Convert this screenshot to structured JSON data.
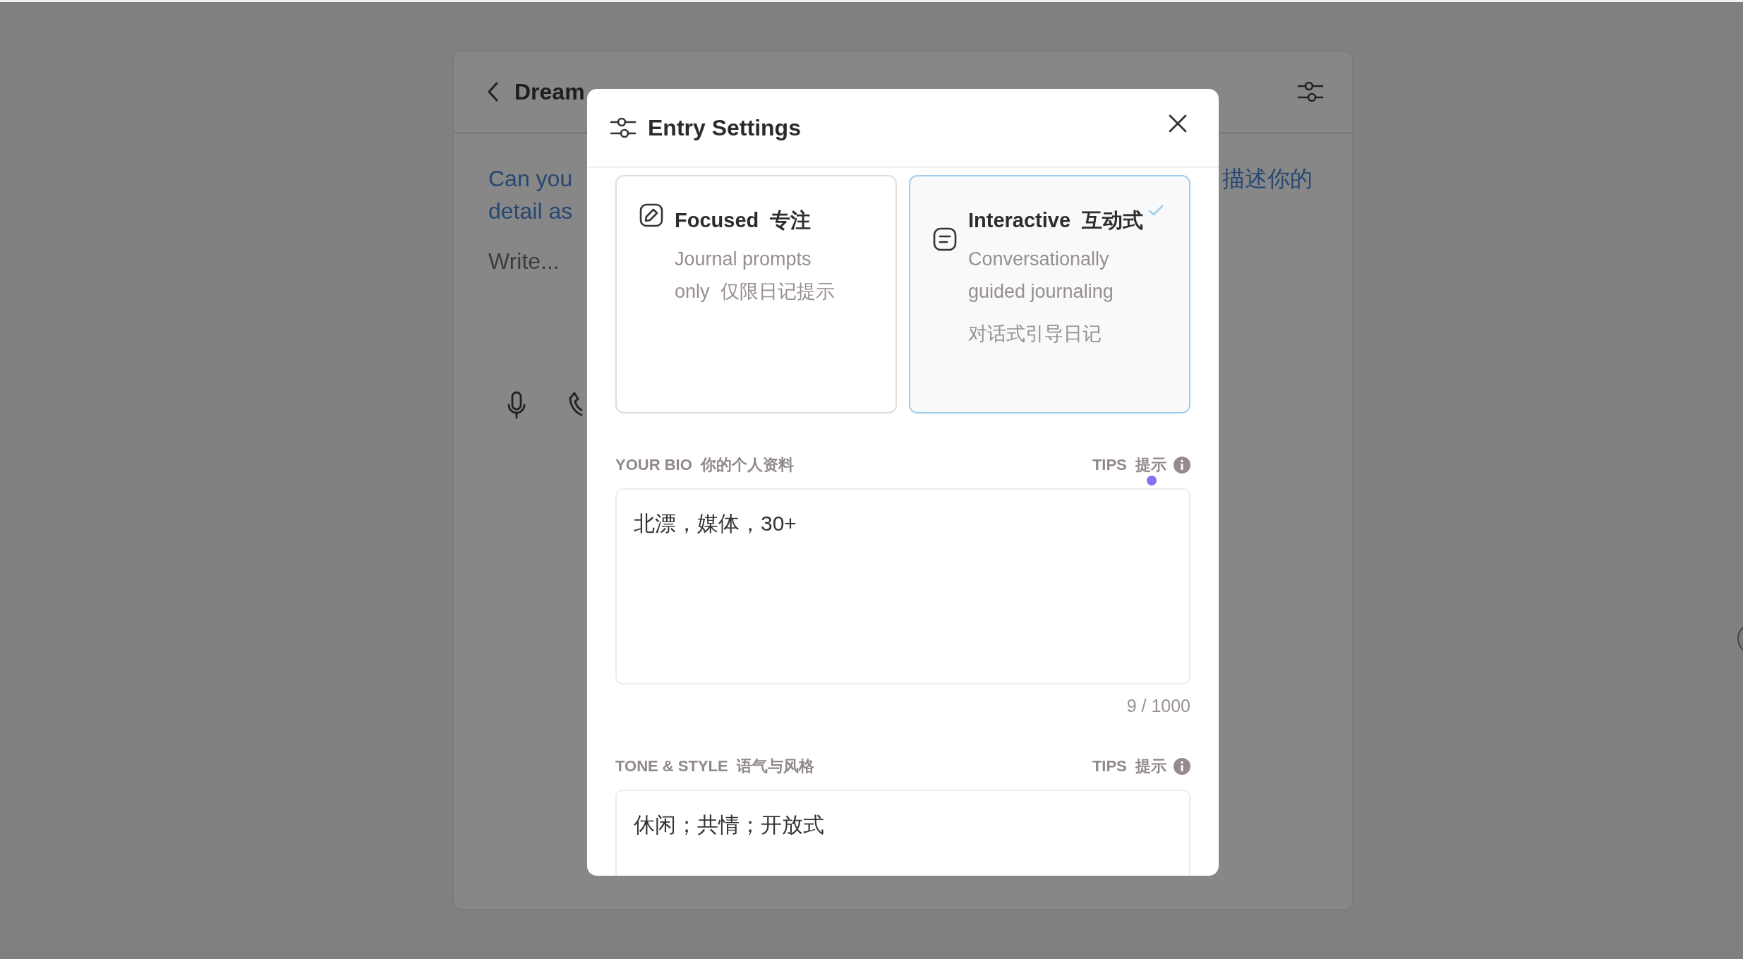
{
  "background": {
    "title": "Dream",
    "prompt_lines": [
      "Can you",
      "detail as"
    ],
    "prompt_fragment": "描述你的",
    "placeholder": "Write..."
  },
  "dialog": {
    "title": "Entry Settings",
    "modes": [
      {
        "kind": "focused",
        "title": "Focused  专注",
        "description": [
          "Journal prompts only  仅限日记提示"
        ],
        "selected": false
      },
      {
        "kind": "interactive",
        "title": "Interactive  互动式",
        "description": [
          "Conversationally guided journaling",
          "对话式引导日记"
        ],
        "selected": true
      }
    ],
    "fields": [
      {
        "label": "YOUR BIO  你的个人资料",
        "tips": "TIPS  提示",
        "value": "北漂，媒体，30+",
        "counter": "9 / 1000"
      },
      {
        "label": "TONE & STYLE  语气与风格",
        "tips": "TIPS  提示",
        "value": "休闲；共情；开放式"
      }
    ]
  }
}
